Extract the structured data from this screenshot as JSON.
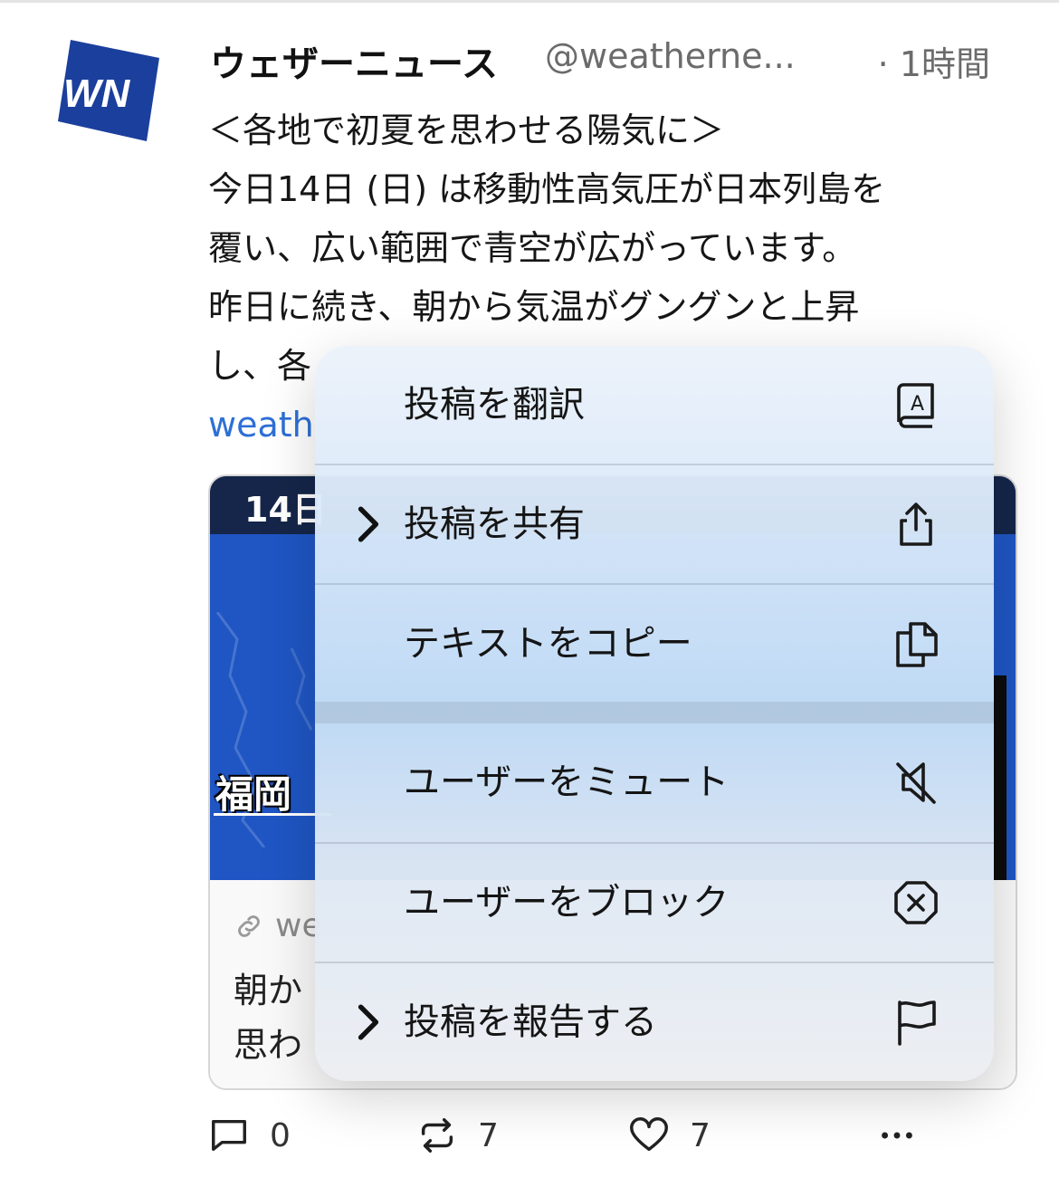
{
  "post": {
    "author": "ウェザーニュース",
    "handle": "@weatherne...",
    "time": "· 1時間",
    "avatar_text": "WN",
    "lines": [
      "＜各地で初夏を思わせる陽気に＞",
      "今日14日 (日) は移動性高気圧が日本列島を",
      "覆い、広い範囲で青空が広がっています。",
      "昨日に続き、朝から気温がグングンと上昇",
      "し、各"
    ],
    "link_fragment": "weath"
  },
  "card": {
    "image_date": "14日",
    "image_city": "福岡",
    "domain_fragment": "we",
    "title_lines": [
      "朝か",
      "思わ"
    ]
  },
  "actions": {
    "reply_count": "0",
    "repost_count": "7",
    "like_count": "7"
  },
  "menu": {
    "items": [
      {
        "label": "投稿を翻訳",
        "icon": "translate-book-icon",
        "submenu": false
      },
      {
        "label": "投稿を共有",
        "icon": "share-icon",
        "submenu": true
      },
      {
        "label": "テキストをコピー",
        "icon": "copy-icon",
        "submenu": false
      },
      {
        "label": "ユーザーをミュート",
        "icon": "mute-speaker-icon",
        "submenu": false
      },
      {
        "label": "ユーザーをブロック",
        "icon": "block-icon",
        "submenu": false
      },
      {
        "label": "投稿を報告する",
        "icon": "flag-icon",
        "submenu": true
      }
    ]
  },
  "colors": {
    "link": "#2d6fd6",
    "brand_blue": "#1b3f9c",
    "muted_text": "#6b6b6b"
  }
}
